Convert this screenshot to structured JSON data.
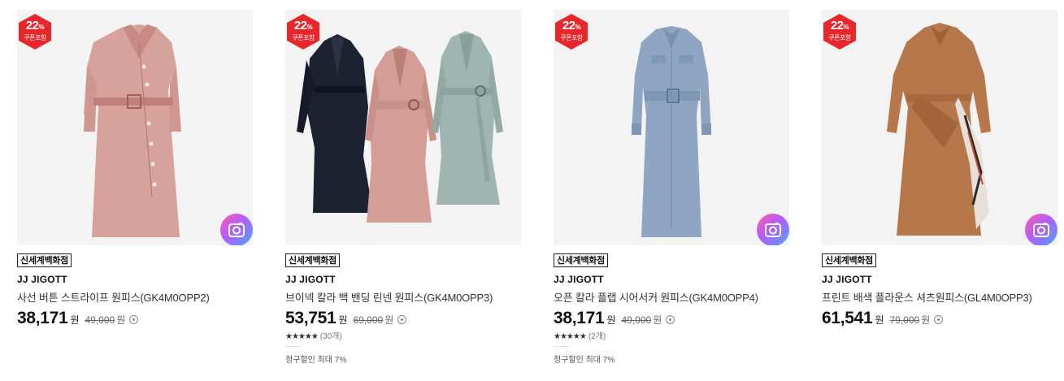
{
  "colors": {
    "badge_red": "#e8272c",
    "camera_gradient": [
      "#ff5fa2",
      "#b35cff",
      "#4aa6ff"
    ]
  },
  "products": [
    {
      "badge_percent": "22",
      "badge_percent_sign": "%",
      "badge_sub": "쿠폰포함",
      "store": "신세계백화점",
      "brand": "JJ JIGOTT",
      "name": "사선 버튼 스트라이프 원피스(GK4M0OPP2)",
      "price": "38,171",
      "currency": "원",
      "original_price": "49,000",
      "original_currency": "원",
      "image_icon": "dress-pink-trench",
      "camera_icon": "camera-icon"
    },
    {
      "badge_percent": "22",
      "badge_percent_sign": "%",
      "badge_sub": "쿠폰포함",
      "store": "신세계백화점",
      "brand": "JJ JIGOTT",
      "name": "브이넥 칼라 백 밴딩 린넨 원피스(GK4M0OPP3)",
      "price": "53,751",
      "currency": "원",
      "original_price": "69,000",
      "original_currency": "원",
      "stars": "★★★★★",
      "rating_count": "(30개)",
      "rating_value": 4.5,
      "discount_text": "청구할인 최대 7%",
      "image_icon": "dress-three-colors",
      "camera_icon": null
    },
    {
      "badge_percent": "22",
      "badge_percent_sign": "%",
      "badge_sub": "쿠폰포함",
      "store": "신세계백화점",
      "brand": "JJ JIGOTT",
      "name": "오픈 칼라 플랩 시어서커 원피스(GK4M0OPP4)",
      "price": "38,171",
      "currency": "원",
      "original_price": "49,000",
      "original_currency": "원",
      "stars": "★★★★★",
      "rating_count": "(2개)",
      "rating_value": 5,
      "discount_text": "청구할인 최대 7%",
      "image_icon": "dress-blue-shirt",
      "camera_icon": "camera-icon"
    },
    {
      "badge_percent": "22",
      "badge_percent_sign": "%",
      "badge_sub": "쿠폰포함",
      "store": "신세계백화점",
      "brand": "JJ JIGOTT",
      "name": "프린트 배색 플라운스 셔츠원피스(GL4M0OPP3)",
      "price": "61,541",
      "currency": "원",
      "original_price": "79,000",
      "original_currency": "원",
      "image_icon": "dress-brown-shirt",
      "camera_icon": "camera-icon"
    }
  ]
}
